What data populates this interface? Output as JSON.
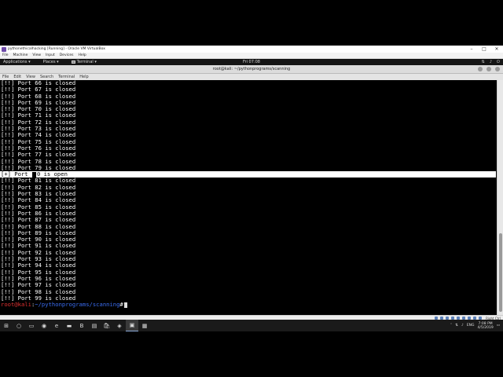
{
  "vbox": {
    "title": "pythonethicalhacking [Running] - Oracle VM VirtualBox",
    "menu": [
      "File",
      "Machine",
      "View",
      "Input",
      "Devices",
      "Help"
    ],
    "window_controls": [
      "–",
      "□",
      "✕"
    ]
  },
  "kali_panel": {
    "applications": "Applications ▾",
    "places": "Places ▾",
    "terminal": "Terminal ▾",
    "clock": "Fri 07:08",
    "tray_icons": [
      "network-icon",
      "volume-icon",
      "power-icon"
    ]
  },
  "terminal": {
    "title": "root@kali: ~/pythonprograms/scanning",
    "menu": [
      "File",
      "Edit",
      "View",
      "Search",
      "Terminal",
      "Help"
    ],
    "lines": [
      "[!!] Port 66 is closed",
      "[!!] Port 67 is closed",
      "[!!] Port 68 is closed",
      "[!!] Port 69 is closed",
      "[!!] Port 70 is closed",
      "[!!] Port 71 is closed",
      "[!!] Port 72 is closed",
      "[!!] Port 73 is closed",
      "[!!] Port 74 is closed",
      "[!!] Port 75 is closed",
      "[!!] Port 76 is closed",
      "[!!] Port 77 is closed",
      "[!!] Port 78 is closed",
      "[!!] Port 79 is closed"
    ],
    "open_line": {
      "prefix": "[+] Port ",
      "suffix": "0 is open"
    },
    "lines_after": [
      "[!!] Port 81 is closed",
      "[!!] Port 82 is closed",
      "[!!] Port 83 is closed",
      "[!!] Port 84 is closed",
      "[!!] Port 85 is closed",
      "[!!] Port 86 is closed",
      "[!!] Port 87 is closed",
      "[!!] Port 88 is closed",
      "[!!] Port 89 is closed",
      "[!!] Port 90 is closed",
      "[!!] Port 91 is closed",
      "[!!] Port 92 is closed",
      "[!!] Port 93 is closed",
      "[!!] Port 94 is closed",
      "[!!] Port 95 is closed",
      "[!!] Port 96 is closed",
      "[!!] Port 97 is closed",
      "[!!] Port 98 is closed",
      "[!!] Port 99 is closed"
    ],
    "prompt": {
      "user": "root@kali",
      "sep": ":",
      "path": "~/pythonprograms/scanning",
      "symbol": "#"
    }
  },
  "vbox_status": {
    "host_key": "Right Ctrl"
  },
  "taskbar": {
    "items": [
      "⊞",
      "○",
      "▭",
      "◉",
      "e",
      "▬",
      "B",
      "▤",
      "🛍",
      "◈",
      "▣",
      "▦"
    ],
    "tray_lang": "ENG",
    "tray_time": "7:08 PM",
    "tray_date": "4/5/2019"
  },
  "colors": {
    "prompt_user": "#e03030",
    "prompt_path": "#3a6cf0",
    "terminal_bg": "#000000",
    "terminal_fg": "#ffffff"
  }
}
